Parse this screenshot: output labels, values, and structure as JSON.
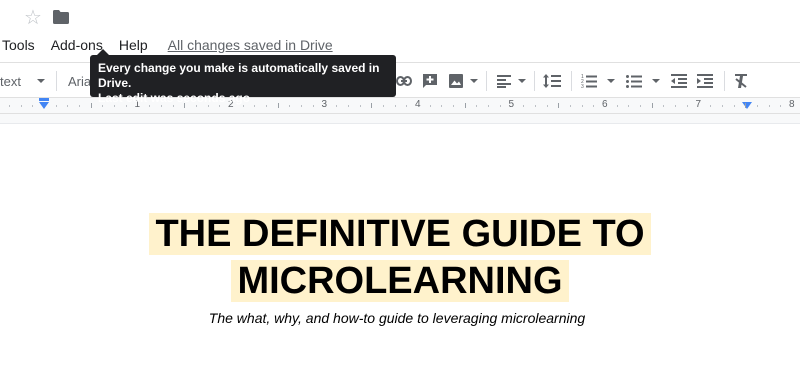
{
  "menu": {
    "items": [
      "Tools",
      "Add-ons",
      "Help"
    ],
    "saved_status": "All changes saved in Drive"
  },
  "toolbar": {
    "style_label": "text",
    "font_label": "Aria"
  },
  "tooltip": {
    "line1": "Every change you make is automatically saved in Drive.",
    "line2": "Last edit was seconds ago"
  },
  "ruler": {
    "numbers": [
      "1",
      "2",
      "3",
      "4",
      "5",
      "6",
      "7",
      "8"
    ]
  },
  "document": {
    "title_line1": "THE DEFINITIVE GUIDE TO",
    "title_line2": "MICROLEARNING",
    "subtitle": "The what, why, and how-to guide to leveraging microlearning"
  },
  "colors": {
    "highlight": "#fff2cc",
    "accent": "#4285f4",
    "tooltip_bg": "#202124"
  },
  "icons": [
    "star-icon",
    "folder-icon",
    "link-icon",
    "insert-comment-icon",
    "insert-image-icon",
    "align-left-icon",
    "line-spacing-icon",
    "numbered-list-icon",
    "bulleted-list-icon",
    "decrease-indent-icon",
    "increase-indent-icon",
    "clear-formatting-icon"
  ]
}
